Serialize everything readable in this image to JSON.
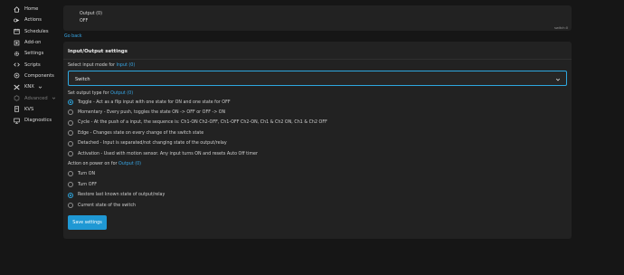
{
  "sidebar": {
    "items": [
      {
        "label": "Home",
        "icon": "home-icon",
        "dim": false
      },
      {
        "label": "Actions",
        "icon": "actions-icon",
        "dim": false
      },
      {
        "label": "Schedules",
        "icon": "calendar-icon",
        "dim": false
      },
      {
        "label": "Add-on",
        "icon": "addon-icon",
        "dim": false
      },
      {
        "label": "Settings",
        "icon": "gear-icon",
        "dim": false
      },
      {
        "label": "Scripts",
        "icon": "code-icon",
        "dim": false
      },
      {
        "label": "Components",
        "icon": "components-icon",
        "dim": false
      },
      {
        "label": "KNX",
        "icon": "knx-icon",
        "dim": false,
        "caret": true
      },
      {
        "label": "Advanced",
        "icon": "advanced-icon",
        "dim": true,
        "caret": true
      },
      {
        "label": "KVS",
        "icon": "kvs-icon",
        "dim": false
      },
      {
        "label": "Diagnostics",
        "icon": "monitor-icon",
        "dim": false
      }
    ]
  },
  "output_card": {
    "title": "Output (0)",
    "state": "OFF",
    "id": "switch:0"
  },
  "go_back": "Go back",
  "settings": {
    "title": "Input/Output settings",
    "input_mode_label": "Select input mode for",
    "input_mode_link": "Input (0)",
    "input_mode_value": "Switch",
    "output_type_label": "Set output type for",
    "output_type_link": "Output (0)",
    "output_types": [
      {
        "text": "Toggle - Act as a flip input with one state for ON and one state for OFF",
        "checked": true
      },
      {
        "text": "Momentary - Every push, toggles the state ON -> OFF or OFF -> ON",
        "checked": false
      },
      {
        "text": "Cycle - At the push of a input, the sequence is: Ch1-ON Ch2-OFF, Ch1-OFF Ch2-ON, Ch1 & Ch2 ON, Ch1 & Ch2 OFF",
        "checked": false
      },
      {
        "text": "Edge - Changes state on every change of the switch state",
        "checked": false
      },
      {
        "text": "Detached - Input is separated/not changing state of the output/relay",
        "checked": false
      },
      {
        "text": "Activation - Used with motion sensor. Any input turns ON and resets Auto Off timer",
        "checked": false
      }
    ],
    "power_on_label": "Action on power on for",
    "power_on_link": "Output (0)",
    "power_on_options": [
      {
        "text": "Turn ON",
        "checked": false
      },
      {
        "text": "Turn OFF",
        "checked": false
      },
      {
        "text": "Restore last known state of output/relay",
        "checked": true
      },
      {
        "text": "Current state of the switch",
        "checked": false
      }
    ],
    "save_label": "Save settings"
  },
  "colors": {
    "accent": "#2ea7df",
    "link": "#38a8e8",
    "background": "#161616",
    "card": "#222222"
  }
}
